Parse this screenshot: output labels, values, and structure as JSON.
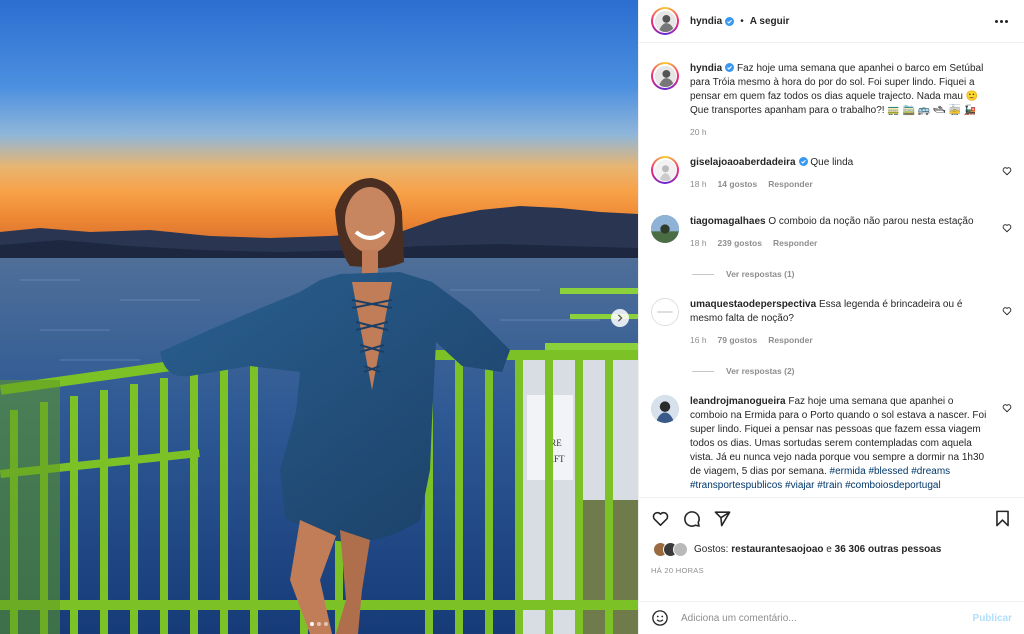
{
  "post": {
    "username": "hyndia",
    "follow_label": "A seguir",
    "bullet": "•"
  },
  "caption": {
    "username": "hyndia",
    "text": "Faz hoje uma semana que apanhei o barco em Setúbal para Tróia mesmo à hora do por do sol. Foi super lindo. Fiquei a pensar em quem faz todos os dias aquele trajecto. Nada mau 🙂 Que transportes apanham para o trabalho?! 🚃 🚞 🚌 🛥 🚋 🚂",
    "time": "20 h"
  },
  "comments": [
    {
      "username": "giselajoaoaberdadeira",
      "verified": true,
      "text": "Que linda",
      "time": "18 h",
      "likes": "14 gostos",
      "reply": "Responder"
    },
    {
      "username": "tiagomagalhaes",
      "verified": false,
      "text": "O comboio da noção não parou nesta estação",
      "time": "18 h",
      "likes": "239 gostos",
      "reply": "Responder",
      "view_replies": "Ver respostas (1)"
    },
    {
      "username": "umaquestaodeperspectiva",
      "verified": false,
      "text": "Essa legenda é brincadeira ou é mesmo falta de noção?",
      "time": "16 h",
      "likes": "79 gostos",
      "reply": "Responder",
      "view_replies": "Ver respostas (2)"
    },
    {
      "username": "leandrojmanogueira",
      "verified": false,
      "text": "Faz hoje uma semana que apanhei o comboio na Ermida para o Porto quando o sol estava a nascer. Foi super lindo. Fiquei a pensar nas pessoas que fazem essa viagem todos os dias. Umas sortudas serem contempladas com aquela vista. Já eu nunca vejo nada porque vou sempre a dormir na 1h30 de viagem, 5 dias por semana.",
      "hashtags": "#ermida #blessed #dreams #transportespublicos #viajar #train #comboiosdeportugal"
    }
  ],
  "likes": {
    "prefix": "Gostos:",
    "first_user": "restaurantesaojoao",
    "connector": "e",
    "others": "36 306 outras pessoas"
  },
  "posted_ago": "HÁ 20 HORAS",
  "comment_input": {
    "placeholder": "Adiciona um comentário...",
    "publish_label": "Publicar"
  },
  "colors": {
    "verified": "#3897f0",
    "hashtag": "#00376b",
    "muted": "#8e8e8e",
    "publish_disabled": "#b2dffc",
    "railing": "#7cc227"
  },
  "icons": {
    "heart": "heart-icon",
    "comment": "comment-icon",
    "share": "share-icon",
    "save": "bookmark-icon",
    "more": "more-options-icon",
    "emoji": "emoji-icon",
    "next": "chevron-right-icon"
  },
  "carousel": {
    "count": 3,
    "active": 1
  }
}
